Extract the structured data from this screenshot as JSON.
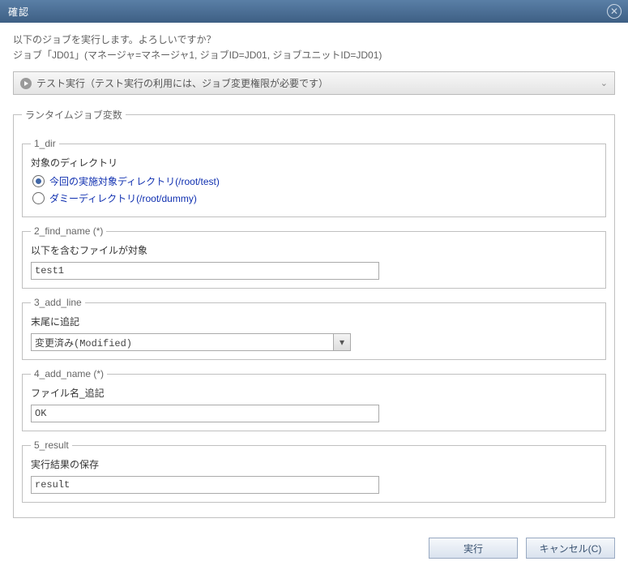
{
  "titlebar": {
    "title": "確認"
  },
  "message": {
    "line1": "以下のジョブを実行します。よろしいですか？",
    "line2": "ジョブ「JD01」(マネージャ=マネージャ1, ジョブID=JD01, ジョブユニットID=JD01)"
  },
  "expander": {
    "label": "テスト実行（テスト実行の利用には、ジョブ変更権限が必要です）"
  },
  "group": {
    "legend": "ランタイムジョブ変数"
  },
  "params": {
    "dir": {
      "legend": "1_dir",
      "desc": "対象のディレクトリ",
      "options": [
        {
          "label": "今回の実施対象ディレクトリ(/root/test)",
          "checked": true
        },
        {
          "label": "ダミーディレクトリ(/root/dummy)",
          "checked": false
        }
      ]
    },
    "find_name": {
      "legend": "2_find_name (*)",
      "desc": "以下を含むファイルが対象",
      "value": "test1"
    },
    "add_line": {
      "legend": "3_add_line",
      "desc": "末尾に追記",
      "selected": "変更済み(Modified)"
    },
    "add_name": {
      "legend": "4_add_name (*)",
      "desc": "ファイル名_追記",
      "value": "OK"
    },
    "result": {
      "legend": "5_result",
      "desc": "実行結果の保存",
      "value": "result"
    }
  },
  "buttons": {
    "execute": "実行",
    "cancel": "キャンセル(C)"
  }
}
